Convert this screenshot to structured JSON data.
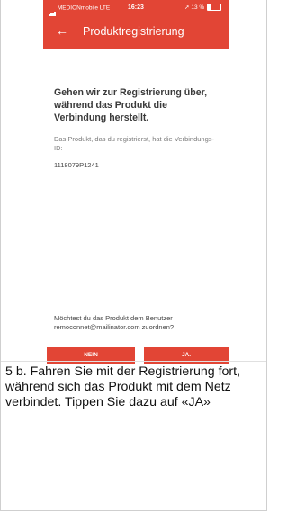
{
  "status_bar": {
    "carrier": "MEDIONmobile",
    "network": "LTE",
    "time": "16:23",
    "battery": "13 %",
    "icons": [
      "signal-icon",
      "location-arrow-icon",
      "battery-icon"
    ]
  },
  "header": {
    "title": "Produktregistrierung",
    "back_icon": "←",
    "color": "#e24535"
  },
  "main": {
    "heading": "Gehen wir zur Registrierung über, während das Produkt die Verbindung herstellt.",
    "description": "Das Produkt, das du registrierst, hat die Verbindungs-ID:",
    "connection_id": "1118079P1241",
    "assign_question": "Möchtest du das Produkt dem Benutzer remoconnet@mailinator.com zuordnen?"
  },
  "buttons": {
    "no_label": "NEIN",
    "yes_label": "JA."
  },
  "caption": "5 b. Fahren Sie mit der Registrierung fort, während sich das Produkt mit dem Netz verbindet. Tippen Sie dazu auf «JA»"
}
